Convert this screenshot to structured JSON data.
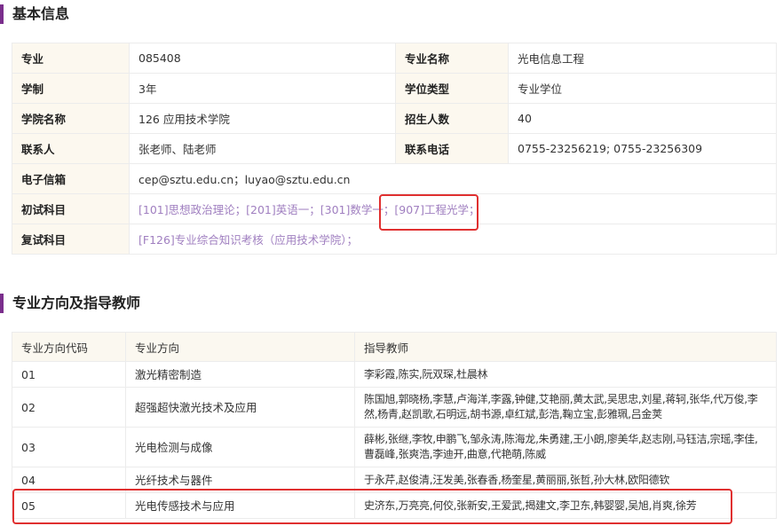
{
  "section1": {
    "title": "基本信息"
  },
  "info": {
    "major_label": "专业",
    "major_value": "085408",
    "major_name_label": "专业名称",
    "major_name_value": "光电信息工程",
    "duration_label": "学制",
    "duration_value": "3年",
    "degree_type_label": "学位类型",
    "degree_type_value": "专业学位",
    "college_label": "学院名称",
    "college_value": "126 应用技术学院",
    "enroll_label": "招生人数",
    "enroll_value": "40",
    "contact_label": "联系人",
    "contact_value": "张老师、陆老师",
    "phone_label": "联系电话",
    "phone_value": "0755-23256219; 0755-23256309",
    "email_label": "电子信箱",
    "email_value": "cep@sztu.edu.cn；luyao@sztu.edu.cn",
    "exam_label": "初试科目",
    "exam_subjects": [
      "[101]思想政治理论；",
      "[201]英语一；",
      "[301]数学一；",
      "[907]工程光学；"
    ],
    "retest_label": "复试科目",
    "retest_subject": "[F126]专业综合知识考核（应用技术学院）；"
  },
  "section2": {
    "title": "专业方向及指导教师"
  },
  "directions": {
    "headers": [
      "专业方向代码",
      "专业方向",
      "指导教师"
    ],
    "rows": [
      {
        "code": "01",
        "name": "激光精密制造",
        "teachers": "李彩霞,陈实,阮双琛,杜晨林"
      },
      {
        "code": "02",
        "name": "超强超快激光技术及应用",
        "teachers": "陈国旭,郭晓杨,李慧,卢海洋,李露,钟健,艾艳丽,黄太武,吴思忠,刘星,蒋轲,张华,代万俊,李然,杨青,赵凯歌,石明远,胡书源,卓红斌,彭浩,鞠立宝,彭雅珮,吕金荚"
      },
      {
        "code": "03",
        "name": "光电检测与成像",
        "teachers": "薛彬,张继,李牧,申鹏飞,邹永涛,陈海龙,朱勇建,王小朗,廖美华,赵志刚,马钰洁,宗瑶,李佳,曹磊峰,张爽浩,李迪开,曲意,代艳萌,陈威"
      },
      {
        "code": "04",
        "name": "光纤技术与器件",
        "teachers": "于永芹,赵俊清,汪发美,张春香,杨奎星,黄丽丽,张哲,孙大林,欧阳德钦"
      },
      {
        "code": "05",
        "name": "光电传感技术与应用",
        "teachers": "史济东,万亮亮,何佼,张新安,王爱武,揭建文,李卫东,韩婴婴,吴旭,肖爽,徐芳"
      }
    ]
  }
}
